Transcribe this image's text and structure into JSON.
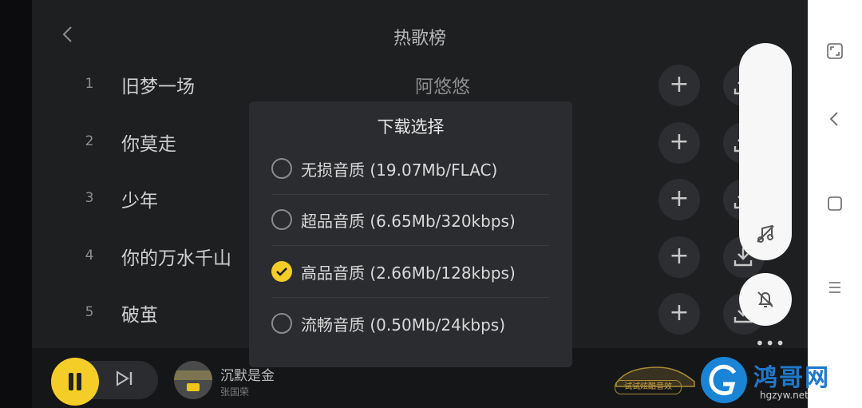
{
  "header": {
    "title": "热歌榜",
    "back_icon": "chevron-left-icon"
  },
  "songs": [
    {
      "rank": "1",
      "title": "旧梦一场",
      "artist": "阿悠悠"
    },
    {
      "rank": "2",
      "title": "你莫走",
      "artist": ""
    },
    {
      "rank": "3",
      "title": "少年",
      "artist": ""
    },
    {
      "rank": "4",
      "title": "你的万水千山",
      "artist": ""
    },
    {
      "rank": "5",
      "title": "破茧",
      "artist": ""
    }
  ],
  "row_actions": {
    "add_symbol": "+",
    "download_icon": "download-icon"
  },
  "download_dialog": {
    "title": "下载选择",
    "options": [
      {
        "label": "无损音质  (19.07Mb/FLAC)",
        "selected": false
      },
      {
        "label": "超品音质  (6.65Mb/320kbps)",
        "selected": false
      },
      {
        "label": "高品音质  (2.66Mb/128kbps)",
        "selected": true
      },
      {
        "label": "流畅音质  (0.50Mb/24kbps)",
        "selected": false
      }
    ]
  },
  "player": {
    "now_playing_title": "沉默是金",
    "now_playing_artist": "张国荣",
    "promo_label": "试试炫酷音效"
  },
  "overlay": {
    "dots": "•••"
  },
  "watermark": {
    "brand": "鸿哥网",
    "url": "hgzyw.net"
  },
  "colors": {
    "accent": "#f4cd28",
    "background": "#1e1f21",
    "dialog": "#2b2c2f",
    "watermark_blue": "#1f79cc"
  }
}
